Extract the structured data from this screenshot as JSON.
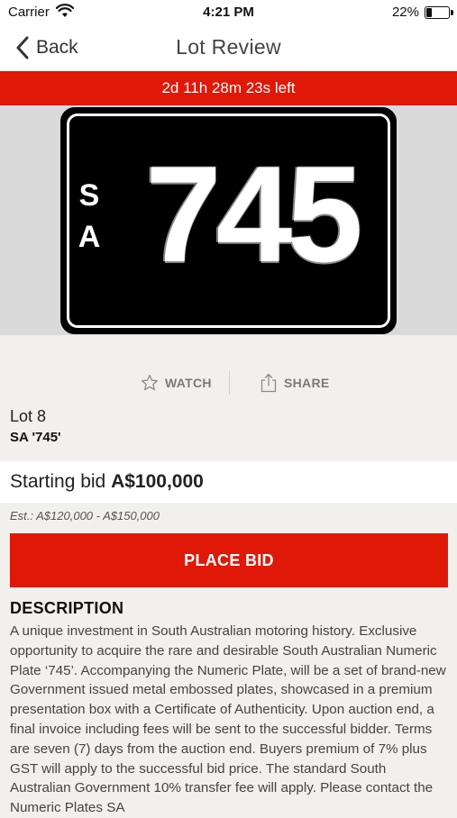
{
  "status_bar": {
    "carrier": "Carrier",
    "time": "4:21 PM",
    "battery": "22%",
    "battery_level": 0.22
  },
  "nav": {
    "back_label": "Back",
    "title": "Lot Review"
  },
  "countdown": "2d 11h 28m 23s left",
  "plate": {
    "state_code": "S A",
    "number": "745"
  },
  "actions": {
    "watch_label": "WATCH",
    "share_label": "SHARE"
  },
  "lot": {
    "number_label": "Lot 8",
    "title": "SA '745'"
  },
  "bid": {
    "label": "Starting bid",
    "amount": "A$100,000",
    "estimate": "Est.: A$120,000 - A$150,000",
    "place_bid_label": "PLACE BID"
  },
  "description": {
    "heading": "DESCRIPTION",
    "body": "A unique investment in South Australian motoring history. Exclusive opportunity to acquire the rare and desirable South Australian Numeric Plate ‘745’. Accompanying the Numeric Plate, will be a set of brand-new Government issued metal embossed plates, showcased in a premium presentation box with a Certificate of Authenticity. Upon auction end, a final invoice including fees will be sent to the successful bidder. Terms are seven (7) days from the auction end. Buyers premium of 7% plus GST will apply to the successful bid price. The standard South Australian Government 10% transfer fee will apply. Please contact the Numeric Plates SA"
  },
  "colors": {
    "accent_red": "#e01808",
    "background": "#f1f0ec",
    "plate_black": "#000000"
  }
}
